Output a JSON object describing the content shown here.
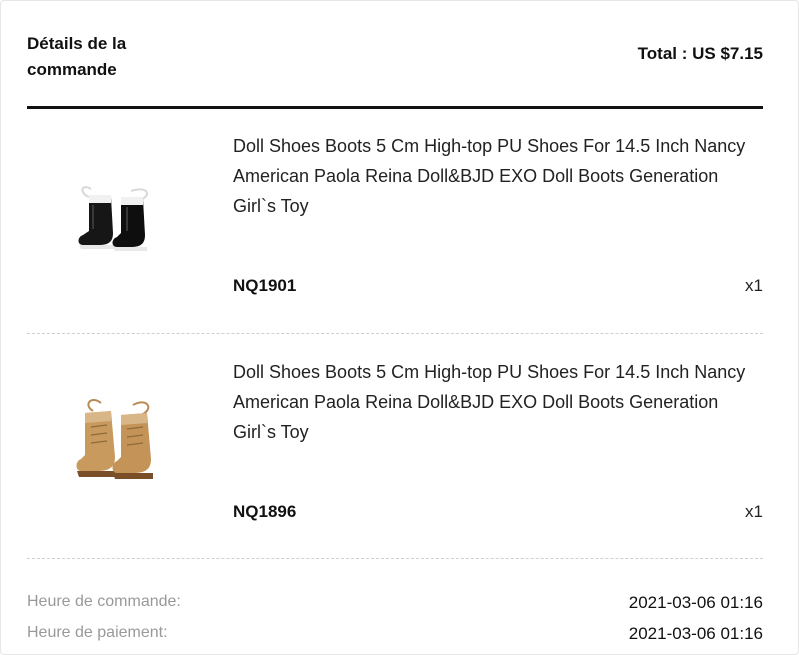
{
  "order": {
    "title": "Détails de la commande",
    "total": "Total : US $7.15"
  },
  "items": [
    {
      "description": "Doll Shoes Boots 5 Cm High-top PU Shoes For 14.5 Inch Nancy American Paola Reina Doll&BJD EXO Doll Boots Generation Girl`s Toy",
      "sku": "NQ1901",
      "quantity": "x1",
      "image_icon": "black-doll-boots-icon",
      "image_color": "#1a1a1a"
    },
    {
      "description": "Doll Shoes Boots 5 Cm High-top PU Shoes For 14.5 Inch Nancy American Paola Reina Doll&BJD EXO Doll Boots Generation Girl`s Toy",
      "sku": "NQ1896",
      "quantity": "x1",
      "image_icon": "tan-doll-boots-icon",
      "image_color": "#c99a5e"
    }
  ],
  "times": {
    "order_time_label": "Heure de commande:",
    "order_time_value": "2021-03-06 01:16",
    "payment_time_label": "Heure de paiement:",
    "payment_time_value": "2021-03-06 01:16"
  },
  "colors": {
    "text": "#111111",
    "muted": "#999999",
    "divider": "#cfcfcf"
  }
}
